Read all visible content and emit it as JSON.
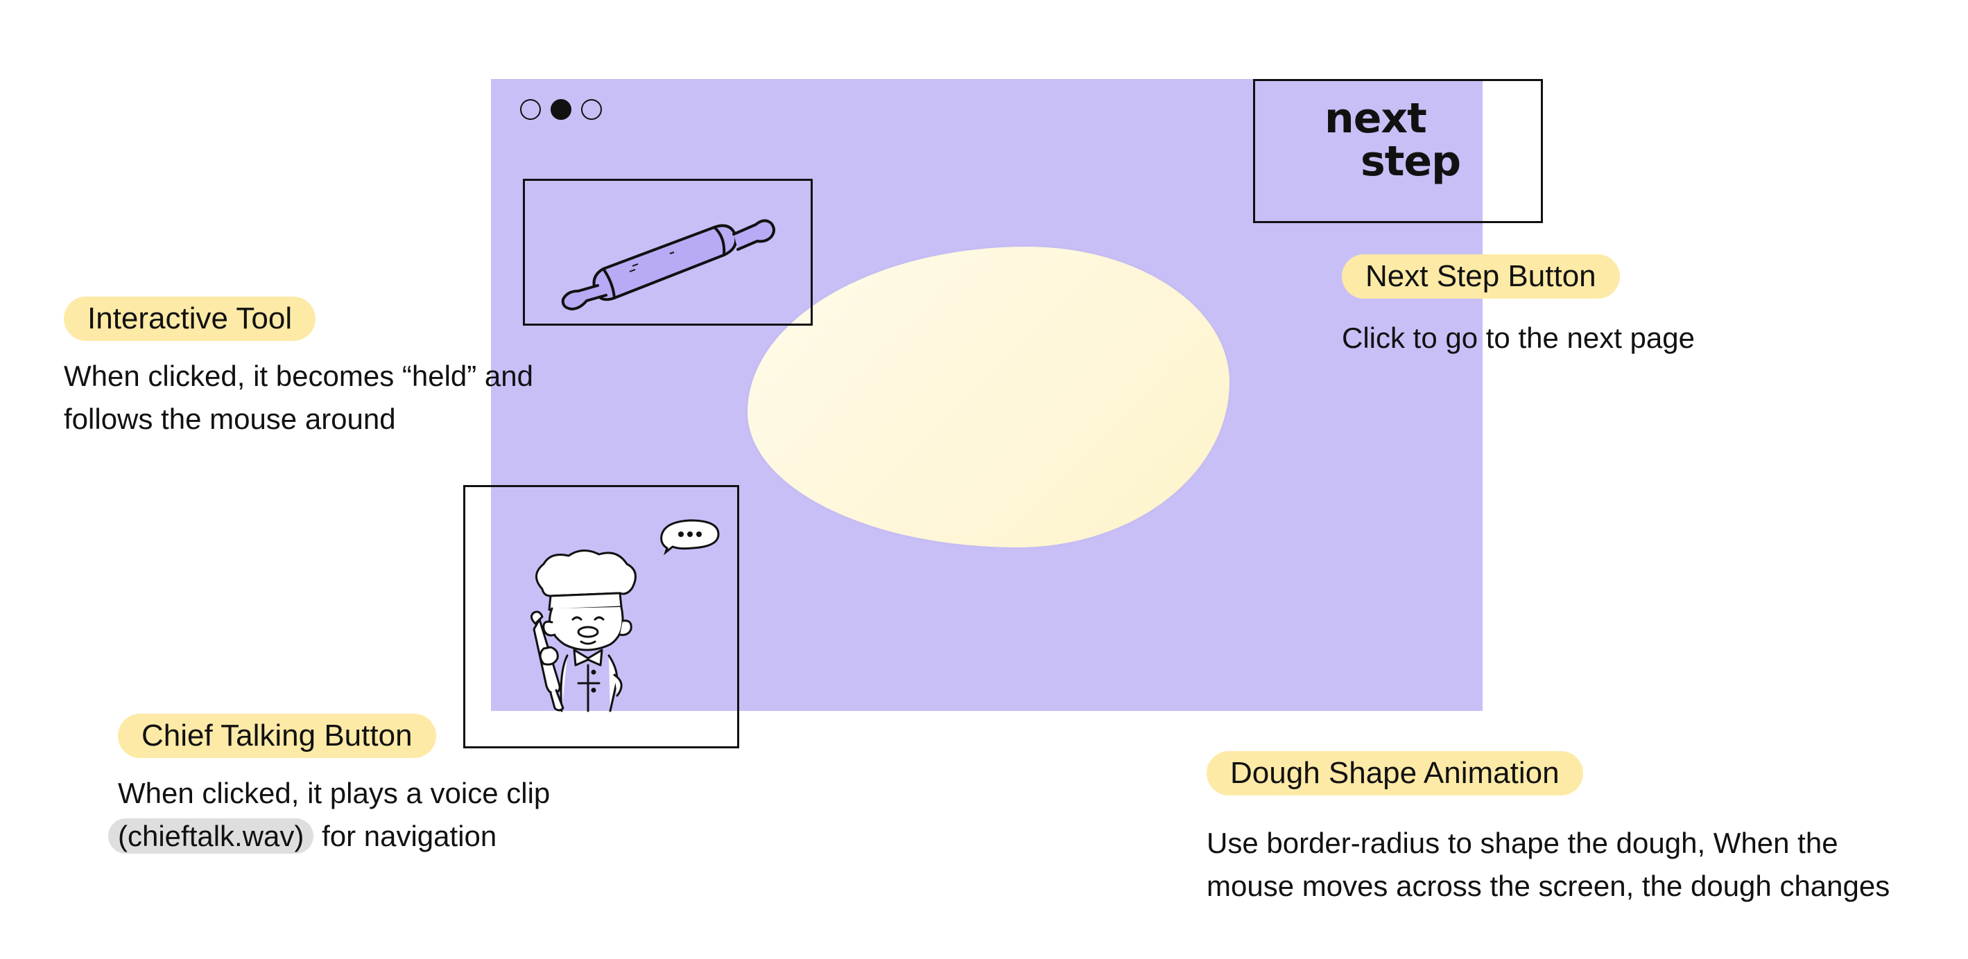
{
  "stage": {
    "background_color": "#c9bff7"
  },
  "page_dots": {
    "count": 3,
    "active_index": 1
  },
  "next_button": {
    "line1": "next",
    "line2": "step"
  },
  "dough": {
    "color": "#fdf3cb"
  },
  "annotations": {
    "tool": {
      "title": "Interactive Tool",
      "line1": "When clicked, it becomes “held” and",
      "line2": "follows the mouse around"
    },
    "next_step": {
      "title": "Next Step Button",
      "line1": "Click to go to the next page"
    },
    "chief": {
      "title": "Chief Talking Button",
      "line1": "When clicked, it plays a voice clip",
      "code": "(chieftalk.wav)",
      "line2_rest": " for navigation"
    },
    "dough": {
      "title": "Dough Shape Animation",
      "line1": "Use border-radius to shape the dough, When the",
      "line2": "mouse moves across the screen, the dough changes"
    }
  },
  "speech_bubble_text": "•••",
  "pill_color": "#fdeaa6"
}
